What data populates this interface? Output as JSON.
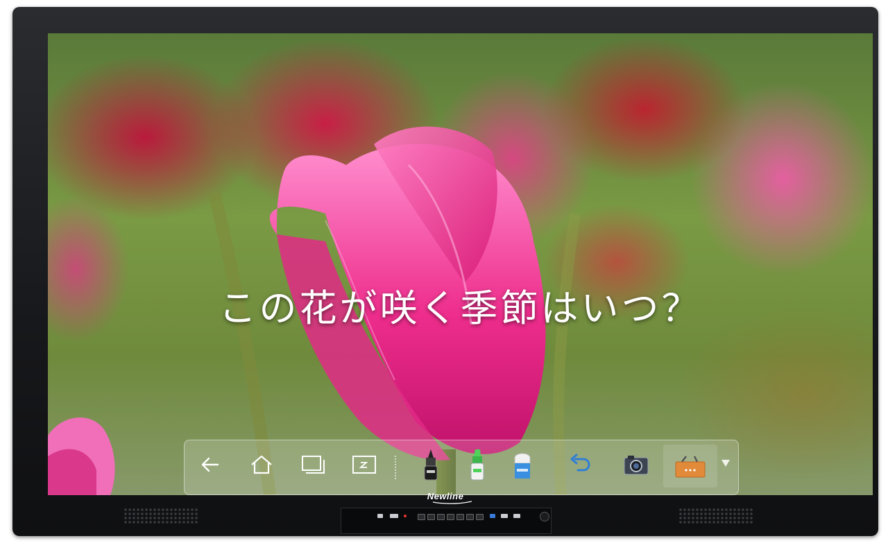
{
  "screen": {
    "question_text": "この花が咲く季節はいつ？"
  },
  "toolbar": {
    "buttons": [
      {
        "name": "back",
        "icon": "back-arrow-icon"
      },
      {
        "name": "home",
        "icon": "home-icon"
      },
      {
        "name": "recent-windows",
        "icon": "windows-icon"
      },
      {
        "name": "whiteboard",
        "icon": "whiteboard-icon"
      },
      {
        "name": "pen",
        "icon": "marker-pen-icon"
      },
      {
        "name": "highlighter",
        "icon": "highlighter-icon"
      },
      {
        "name": "eraser",
        "icon": "eraser-icon"
      },
      {
        "name": "undo",
        "icon": "undo-icon"
      },
      {
        "name": "screenshot",
        "icon": "camera-icon"
      },
      {
        "name": "tools",
        "icon": "toolbox-icon"
      }
    ]
  },
  "device": {
    "brand": "Newline"
  },
  "colors": {
    "bezel": "#17181b",
    "highlighter": "#4fd15a",
    "undo": "#2f7fd6",
    "toolbox": "#e08a3a"
  }
}
